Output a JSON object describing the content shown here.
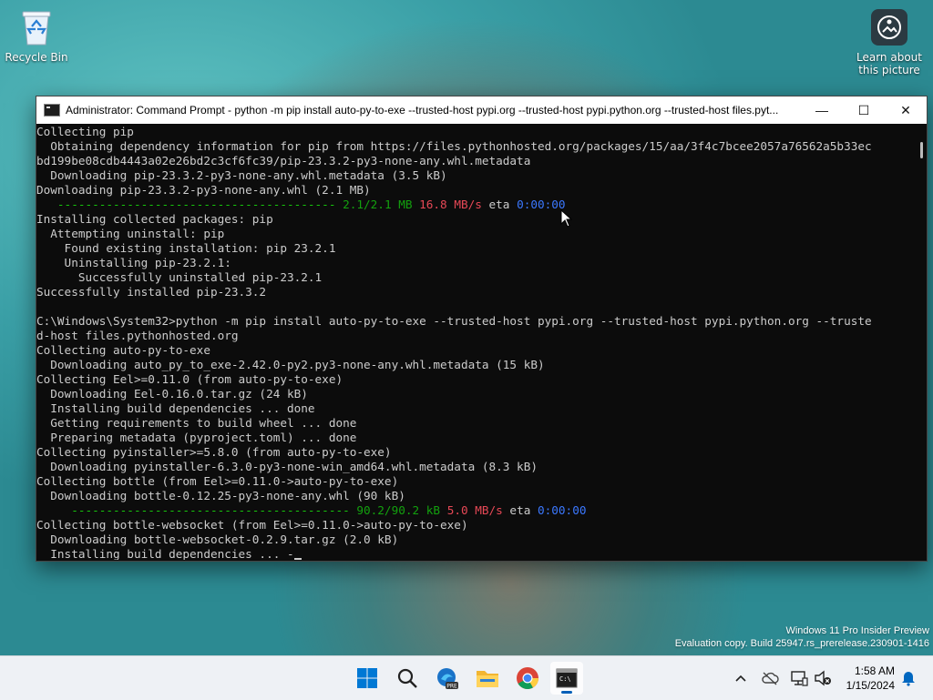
{
  "desktop": {
    "recycle_bin_label": "Recycle Bin",
    "learn_label_line1": "Learn about",
    "learn_label_line2": "this picture"
  },
  "window": {
    "title": "Administrator: Command Prompt - python  -m pip install auto-py-to-exe --trusted-host pypi.org --trusted-host pypi.python.org --trusted-host files.pyt...",
    "minimize_glyph": "—",
    "maximize_glyph": "☐",
    "close_glyph": "✕"
  },
  "console": {
    "lines": [
      "Collecting pip",
      "  Obtaining dependency information for pip from https://files.pythonhosted.org/packages/15/aa/3f4c7bcee2057a76562a5b33ec",
      "bd199be08cdb4443a02e26bd2c3cf6fc39/pip-23.3.2-py3-none-any.whl.metadata",
      "  Downloading pip-23.3.2-py3-none-any.whl.metadata (3.5 kB)",
      "Downloading pip-23.3.2-py3-none-any.whl (2.1 MB)",
      "PROGRESS1",
      "Installing collected packages: pip",
      "  Attempting uninstall: pip",
      "    Found existing installation: pip 23.2.1",
      "    Uninstalling pip-23.2.1:",
      "      Successfully uninstalled pip-23.2.1",
      "Successfully installed pip-23.3.2",
      "",
      "C:\\Windows\\System32>python -m pip install auto-py-to-exe --trusted-host pypi.org --trusted-host pypi.python.org --truste",
      "d-host files.pythonhosted.org",
      "Collecting auto-py-to-exe",
      "  Downloading auto_py_to_exe-2.42.0-py2.py3-none-any.whl.metadata (15 kB)",
      "Collecting Eel>=0.11.0 (from auto-py-to-exe)",
      "  Downloading Eel-0.16.0.tar.gz (24 kB)",
      "  Installing build dependencies ... done",
      "  Getting requirements to build wheel ... done",
      "  Preparing metadata (pyproject.toml) ... done",
      "Collecting pyinstaller>=5.8.0 (from auto-py-to-exe)",
      "  Downloading pyinstaller-6.3.0-py3-none-win_amd64.whl.metadata (8.3 kB)",
      "Collecting bottle (from Eel>=0.11.0->auto-py-to-exe)",
      "  Downloading bottle-0.12.25-py3-none-any.whl (90 kB)",
      "PROGRESS2",
      "Collecting bottle-websocket (from Eel>=0.11.0->auto-py-to-exe)",
      "  Downloading bottle-websocket-0.2.9.tar.gz (2.0 kB)",
      "  Installing build dependencies ... -"
    ],
    "progress1": {
      "bar": "   ---------------------------------------- ",
      "size": "2.1/2.1 MB",
      "speed": "16.8 MB/s",
      "eta_label": " eta ",
      "eta": "0:00:00"
    },
    "progress2": {
      "bar": "     ---------------------------------------- ",
      "size": "90.2/90.2 kB",
      "speed": "5.0 MB/s",
      "eta_label": " eta ",
      "eta": "0:00:00"
    }
  },
  "watermark": {
    "line1": "Windows 11 Pro Insider Preview",
    "line2": "Evaluation copy. Build 25947.rs_prerelease.230901-1416"
  },
  "taskbar": {
    "time": "1:58 AM",
    "date": "1/15/2024",
    "apps": [
      "start-icon",
      "search-icon",
      "edge-beta-icon",
      "file-explorer-icon",
      "chrome-icon",
      "command-prompt-icon"
    ]
  },
  "colors": {
    "console_bg": "#0c0c0c",
    "console_text": "#cccccc",
    "progress_green": "#13a10e",
    "progress_red": "#e74856",
    "progress_blue": "#3b78ff"
  }
}
